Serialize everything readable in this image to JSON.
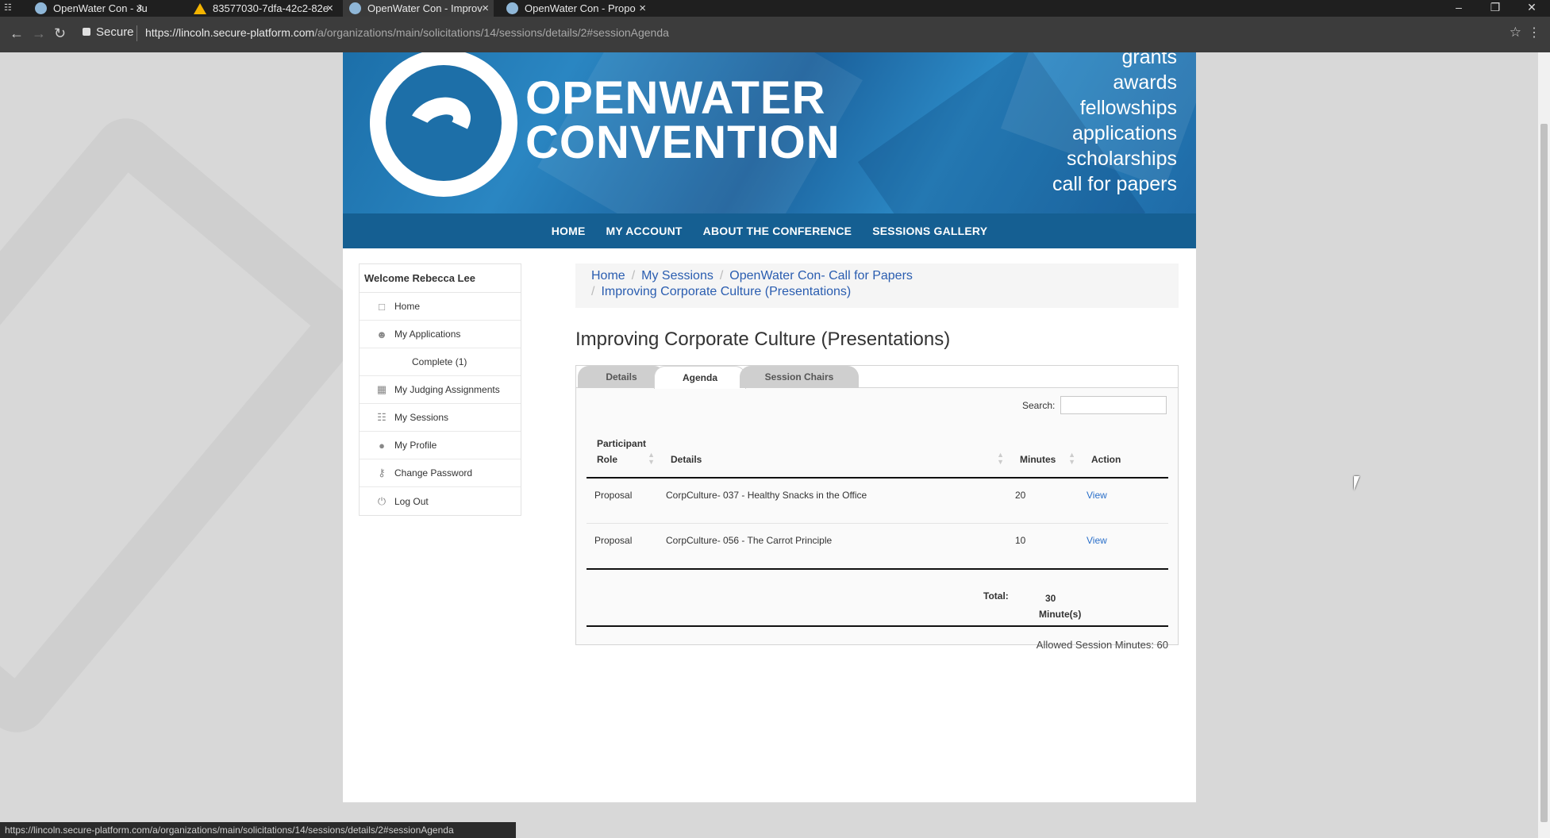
{
  "browser": {
    "tabs": [
      {
        "title": "OpenWater Con - Judging",
        "active": false,
        "icon": "openwater-favicon"
      },
      {
        "title": "83577030-7dfa-42c2-82e",
        "active": false,
        "icon": "drive-favicon"
      },
      {
        "title": "OpenWater Con - Improv",
        "active": true,
        "icon": "openwater-favicon"
      },
      {
        "title": "OpenWater Con - Propo",
        "active": false,
        "icon": "openwater-favicon"
      }
    ],
    "secure_label": "Secure",
    "url_host": "https://lincoln.secure-platform.com",
    "url_path": "/a/organizations/main/solicitations/14/sessions/details/2#sessionAgenda",
    "status_url": "https://lincoln.secure-platform.com/a/organizations/main/solicitations/14/sessions/details/2#sessionAgenda"
  },
  "banner": {
    "brand_line1": "OPENWATER",
    "brand_line2": "CONVENTION",
    "taglines": [
      "grants",
      "awards",
      "fellowships",
      "applications",
      "scholarships",
      "call for papers"
    ]
  },
  "topnav": [
    "HOME",
    "MY ACCOUNT",
    "ABOUT THE CONFERENCE",
    "SESSIONS GALLERY"
  ],
  "sidebar": {
    "welcome": "Welcome Rebecca Lee",
    "items": [
      {
        "label": "Home",
        "icon": "home-icon"
      },
      {
        "label": "My Applications",
        "icon": "applications-icon"
      },
      {
        "label": "Complete (1)",
        "icon": ""
      },
      {
        "label": "My Judging Assignments",
        "icon": "judging-icon"
      },
      {
        "label": "My Sessions",
        "icon": "sessions-icon"
      },
      {
        "label": "My Profile",
        "icon": "profile-icon"
      },
      {
        "label": "Change Password",
        "icon": "key-icon"
      },
      {
        "label": "Log Out",
        "icon": "power-icon"
      }
    ]
  },
  "breadcrumb": {
    "items": [
      "Home",
      "My Sessions",
      "OpenWater Con- Call for Papers",
      "Improving Corporate Culture (Presentations)"
    ]
  },
  "main": {
    "title": "Improving Corporate Culture (Presentations)",
    "tabs": [
      "Details",
      "Agenda",
      "Session Chairs"
    ],
    "active_tab": "Agenda",
    "search_label": "Search:",
    "search_value": "",
    "columns": [
      "Participant Role",
      "Details",
      "Minutes",
      "Action"
    ],
    "rows": [
      {
        "role": "Proposal",
        "details": "CorpCulture- 037 - Healthy Snacks in the Office",
        "minutes": "20",
        "action": "View"
      },
      {
        "role": "Proposal",
        "details": "CorpCulture- 056 - The Carrot Principle",
        "minutes": "10",
        "action": "View"
      }
    ],
    "total_label": "Total:",
    "total_value": "30",
    "total_unit": "Minute(s)",
    "allowed": "Allowed Session Minutes: 60"
  }
}
